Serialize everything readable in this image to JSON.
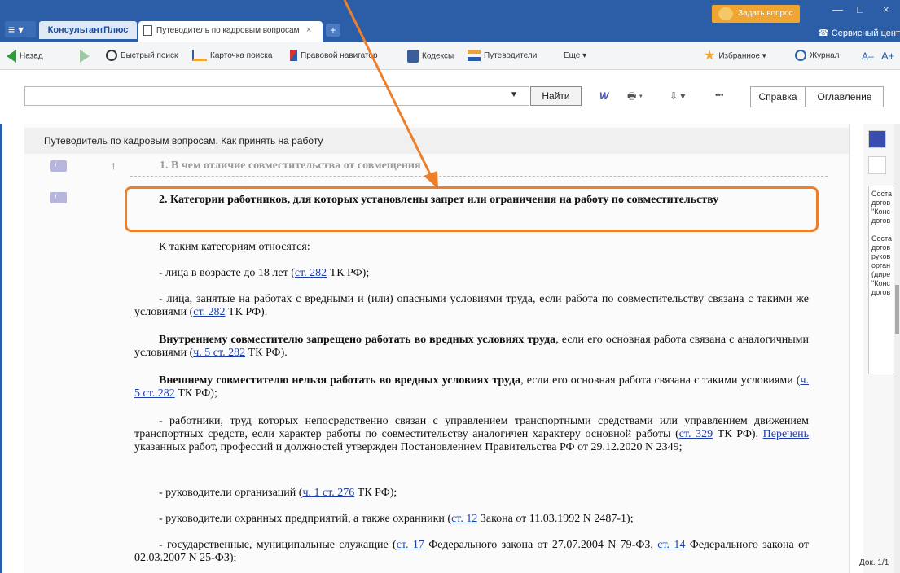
{
  "window": {
    "menu_label": "≡ ▾",
    "brand_tab": "КонсультантПлюс",
    "doc_tab": "Путеводитель по кадровым вопросам",
    "tab_close": "×",
    "tab_add": "+",
    "ask_button": "Задать вопрос",
    "service_center": "Сервисный центр",
    "minimize": "—",
    "maximize": "□",
    "close": "×"
  },
  "toolbar": {
    "back": "Назад",
    "quick_search": "Быстрый поиск",
    "search_card": "Карточка поиска",
    "legal_navigator": "Правовой навигатор",
    "codes": "Кодексы",
    "guides": "Путеводители",
    "more": "Еще ▾",
    "favorites": "Избранное ▾",
    "journal": "Журнал",
    "font_minus": "A–",
    "font_plus": "A+"
  },
  "search": {
    "value": "",
    "find_button": "Найти",
    "help_button": "Справка",
    "toc_button": "Оглавление",
    "word_icon": "W",
    "print_icon": "🖶 ▾",
    "export_icon": "⇩ ▾",
    "more_icon": "•••"
  },
  "document": {
    "title": "Путеводитель по кадровым вопросам. Как принять на работу",
    "section1": "1. В чем отличие совместительства от совмещения",
    "section2": "2. Категории работников, для которых установлены запрет или ограничения на работу по совместительству",
    "p1": "К таким категориям относятся:",
    "p2_a": "- лица в возрасте до 18 лет (",
    "p2_link": "ст. 282",
    "p2_b": " ТК РФ);",
    "p3_a": "- лица, занятые на работах с вредными и (или) опасными условиями труда, если работа по совместительству связана с такими же условиями (",
    "p3_link": "ст. 282",
    "p3_b": " ТК РФ).",
    "p4_bold": "Внутреннему совместителю запрещено работать во вредных условиях труда",
    "p4_a": ", если его основная работа связана с аналогичными условиями (",
    "p4_link": "ч. 5 ст. 282",
    "p4_b": " ТК РФ).",
    "p5_bold": "Внешнему совместителю нельзя работать во вредных условиях труда",
    "p5_a": ", если его основная работа связана с такими условиями (",
    "p5_link": "ч. 5 ст. 282",
    "p5_b": " ТК РФ);",
    "p6_a": "- работники, труд которых непосредственно связан с управлением транспортными средствами или управлением движением транспортных средств, если характер работы по совместительству аналогичен характеру основной работы (",
    "p6_link1": "ст. 329",
    "p6_b": " ТК РФ). ",
    "p6_link2": "Перечень",
    "p6_c": " указанных работ, профессий и должностей утвержден Постановлением Правительства РФ от 29.12.2020 N 2349;",
    "p7_a": "- руководители организаций (",
    "p7_link": "ч. 1 ст. 276",
    "p7_b": " ТК РФ);",
    "p8_a": "- руководители охранных предприятий, а также охранники (",
    "p8_link": "ст. 12",
    "p8_b": " Закона от 11.03.1992 N 2487-1);",
    "p9_a": "- государственные, муниципальные служащие (",
    "p9_link1": "ст. 17",
    "p9_b": " Федерального закона от 27.07.2004 N 79-ФЗ, ",
    "p9_link2": "ст. 14",
    "p9_c": " Федерального закона от 02.03.2007 N 25-ФЗ);"
  },
  "side_panel": {
    "text": "Соста\nдогов\n\"Конс\nдогов\n\nСоста\nдогов\nруков\nорган\n(дире\n\"Конс\nдогов",
    "doc_count": "Док. 1/1"
  },
  "colors": {
    "brand_blue": "#2b5ea7",
    "highlight_orange": "#ec7f2c",
    "link_blue": "#1f3fa8"
  }
}
